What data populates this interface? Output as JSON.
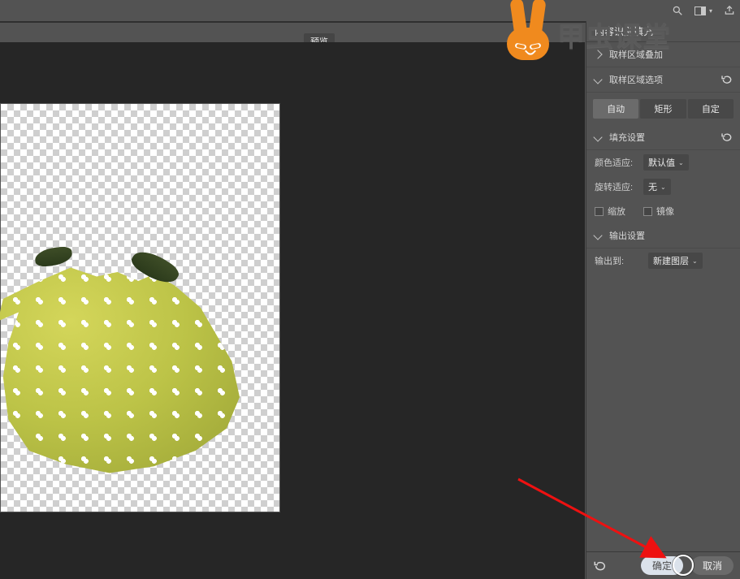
{
  "topbar": {
    "search_icon": "search-icon",
    "workspace_icon": "workspace-icon",
    "share_icon": "share-icon"
  },
  "tab": {
    "label": "预览"
  },
  "panel": {
    "title": "内容识别填充",
    "sections": {
      "sampling_overlay": {
        "label": "取样区域叠加"
      },
      "sampling_options": {
        "label": "取样区域选项",
        "btn_auto": "自动",
        "btn_rect": "矩形",
        "btn_custom": "自定"
      },
      "fill_settings": {
        "label": "填充设置",
        "color_adapt_label": "颜色适应:",
        "color_adapt_value": "默认值",
        "rotation_adapt_label": "旋转适应:",
        "rotation_adapt_value": "无",
        "scale_label": "缩放",
        "mirror_label": "镜像"
      },
      "output_settings": {
        "label": "输出设置",
        "output_to_label": "输出到:",
        "output_to_value": "新建图层"
      }
    }
  },
  "footer": {
    "ok": "确定",
    "cancel": "取消"
  },
  "watermark": {
    "text": "甲虫课堂"
  }
}
